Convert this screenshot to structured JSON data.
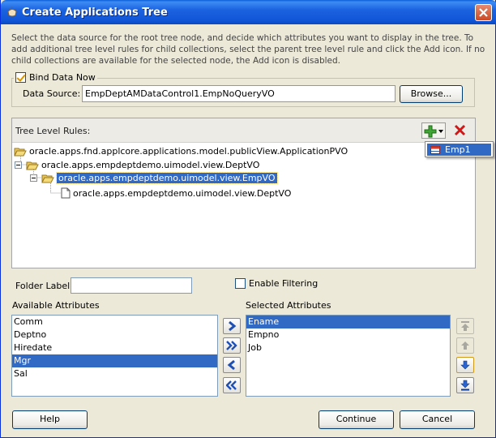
{
  "window": {
    "title": "Create Applications Tree",
    "description": "Select the data source for the root tree node, and decide which attributes you want to display in the tree. To add additional tree level rules for child collections, select the parent tree level rule and click the Add icon. If no child collections are available for the selected node, the Add icon is disabled."
  },
  "bind": {
    "checkbox_label": "Bind Data Now",
    "checked": true,
    "data_source_label": "Data Source:",
    "data_source_value": "EmpDeptAMDataControl1.EmpNoQueryVO",
    "browse_label": "Browse..."
  },
  "tree": {
    "header_label": "Tree Level Rules:",
    "nodes": [
      {
        "label": "oracle.apps.fnd.applcore.applications.model.publicView.ApplicationPVO",
        "type": "folder"
      },
      {
        "label": "oracle.apps.empdeptdemo.uimodel.view.DeptVO",
        "type": "folder"
      },
      {
        "label": "oracle.apps.empdeptdemo.uimodel.view.EmpVO",
        "type": "folder",
        "selected": true
      },
      {
        "label": "oracle.apps.empdeptdemo.uimodel.view.DeptVO",
        "type": "file"
      }
    ],
    "popup_item": "Emp1"
  },
  "folder_label": {
    "label": "Folder Label:",
    "value": ""
  },
  "enable_filtering": {
    "label": "Enable Filtering",
    "checked": false
  },
  "available": {
    "label": "Available Attributes",
    "items": [
      "Comm",
      "Deptno",
      "Hiredate",
      "Mgr",
      "Sal"
    ],
    "selected_index": 3
  },
  "selected": {
    "label": "Selected Attributes",
    "items": [
      "Ename",
      "Empno",
      "Job"
    ],
    "selected_index": 0
  },
  "buttons": {
    "help": "Help",
    "continue": "Continue",
    "cancel": "Cancel"
  },
  "colors": {
    "title_bar": "#1c63e0",
    "selection": "#316ac5",
    "window_bg": "#ece9d8"
  }
}
